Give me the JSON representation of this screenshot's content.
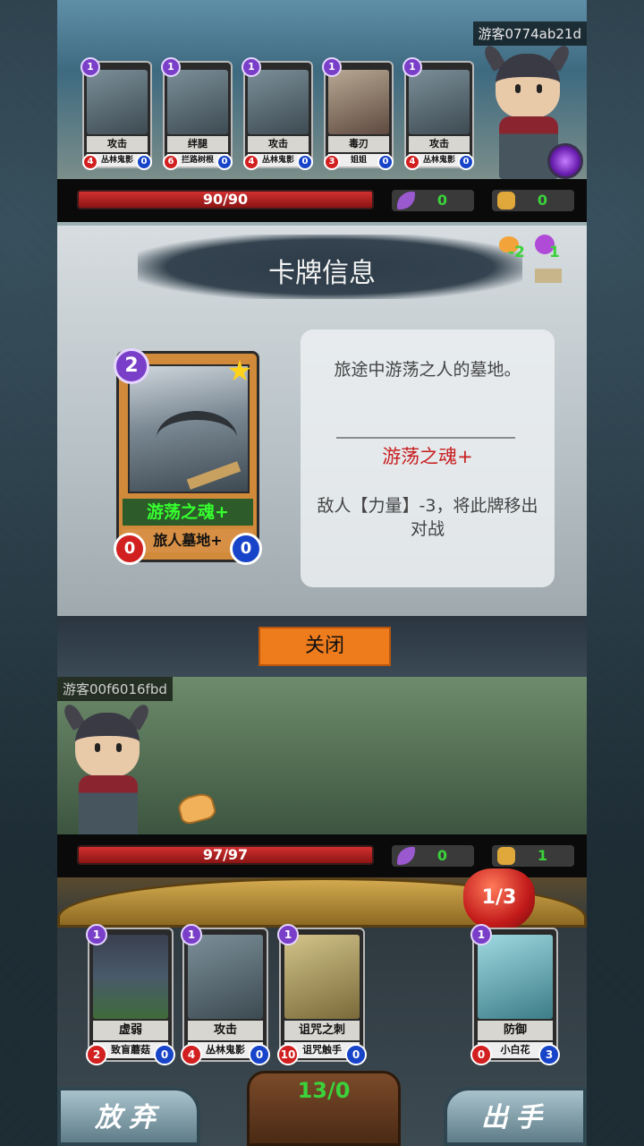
{
  "enemy": {
    "player_name": "游客0774ab21d",
    "hp": "90/90",
    "leaf_count": "0",
    "fist_count": "0",
    "cards": [
      {
        "cost": "1",
        "name": "攻击",
        "sub": "丛林鬼影",
        "atk": "4",
        "def": "0"
      },
      {
        "cost": "1",
        "name": "绊腿",
        "sub": "拦路树根",
        "atk": "6",
        "def": "0"
      },
      {
        "cost": "1",
        "name": "攻击",
        "sub": "丛林鬼影",
        "atk": "4",
        "def": "0"
      },
      {
        "cost": "1",
        "name": "毒刃",
        "sub": "姐姐",
        "atk": "3",
        "def": "0"
      },
      {
        "cost": "1",
        "name": "攻击",
        "sub": "丛林鬼影",
        "atk": "4",
        "def": "0"
      }
    ]
  },
  "card_info": {
    "title": "卡牌信息",
    "mini_res": {
      "food": "-2",
      "orb": "1"
    },
    "card": {
      "cost": "2",
      "star": "★",
      "name": "游荡之魂+",
      "sub": "旅人墓地+",
      "atk": "0",
      "def": "0"
    },
    "flavor": "旅途中游荡之人的墓地。",
    "name": "游荡之魂+",
    "effect": "敌人【力量】-3，将此牌移出对战",
    "close_label": "关闭"
  },
  "player": {
    "player_name": "游客00f6016fbd",
    "hp": "97/97",
    "leaf_count": "0",
    "fist_count": "1",
    "energy": "1/3",
    "deck": "13/0",
    "hand": [
      {
        "cost": "1",
        "name": "虚弱",
        "sub": "致盲蘑菇",
        "atk": "2",
        "def": "0",
        "art": "mush"
      },
      {
        "cost": "1",
        "name": "攻击",
        "sub": "丛林鬼影",
        "atk": "4",
        "def": "0",
        "art": ""
      },
      {
        "cost": "1",
        "name": "诅咒之刺",
        "sub": "诅咒触手",
        "atk": "10",
        "def": "0",
        "art": "tent"
      },
      {
        "cost": "1",
        "name": "防御",
        "sub": "小白花",
        "atk": "0",
        "def": "3",
        "art": "flower"
      }
    ],
    "discard_label": "放弃",
    "play_label": "出手"
  }
}
